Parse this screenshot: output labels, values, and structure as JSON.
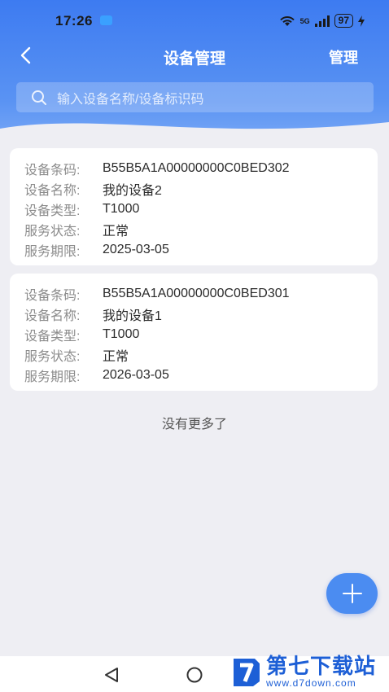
{
  "status_bar": {
    "time": "17:26",
    "network": "5G",
    "battery": "97"
  },
  "header": {
    "title": "设备管理",
    "manage_label": "管理"
  },
  "search": {
    "placeholder": "输入设备名称/设备标识码"
  },
  "devices": [
    {
      "barcode_label": "设备条码:",
      "barcode": "B55B5A1A00000000C0BED302",
      "name_label": "设备名称:",
      "name": "我的设备2",
      "type_label": "设备类型:",
      "type": "T1000",
      "status_label": "服务状态:",
      "status": "正常",
      "expiry_label": "服务期限:",
      "expiry": "2025-03-05"
    },
    {
      "barcode_label": "设备条码:",
      "barcode": "B55B5A1A00000000C0BED301",
      "name_label": "设备名称:",
      "name": "我的设备1",
      "type_label": "设备类型:",
      "type": "T1000",
      "status_label": "服务状态:",
      "status": "正常",
      "expiry_label": "服务期限:",
      "expiry": "2026-03-05"
    }
  ],
  "list_footer": "没有更多了",
  "watermark": {
    "title": "第七下载站",
    "url": "www.d7down.com"
  },
  "colors": {
    "primary": "#3d7bf1",
    "fab": "#4b8cf1",
    "background": "#eeeef3"
  },
  "icons": {
    "back": "chevron-left-icon",
    "search": "search-icon",
    "fab": "plus-icon"
  }
}
